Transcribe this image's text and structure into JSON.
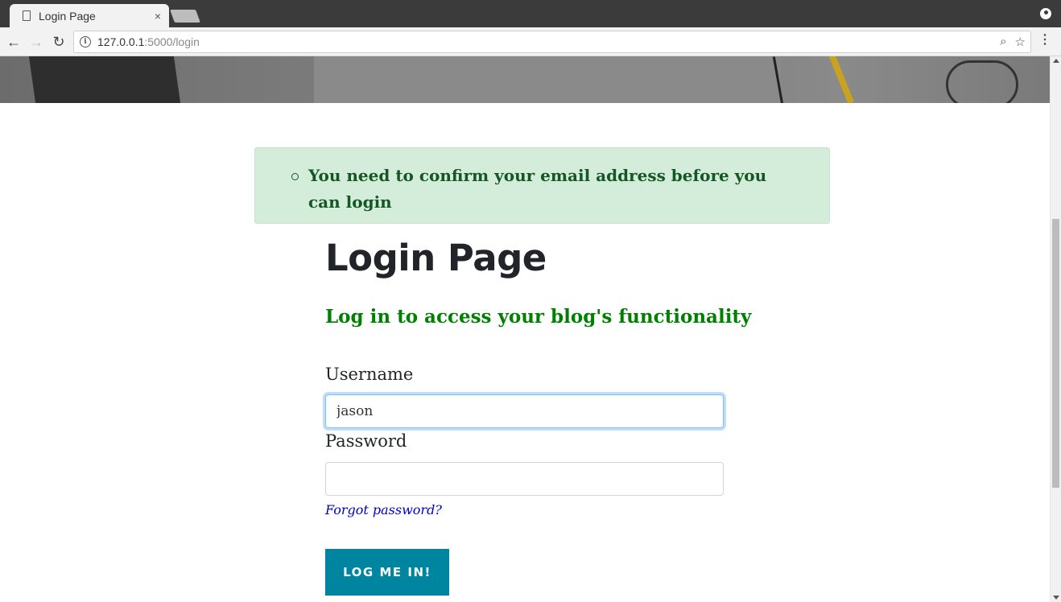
{
  "browser": {
    "tab_title": "Login Page",
    "tab_close": "×",
    "url_host": "127.0.0.1",
    "url_rest": ":5000/login",
    "back_icon": "←",
    "forward_icon": "→",
    "reload_icon": "↻",
    "zoom_icon": "⌕",
    "star_icon": "☆",
    "menu_icon": "⋮"
  },
  "flash": {
    "messages": [
      "You need to confirm your email address before you can login"
    ]
  },
  "page": {
    "title": "Login Page",
    "subtitle": "Log in to access your blog's functionality"
  },
  "form": {
    "username_label": "Username",
    "username_value": "jason",
    "password_label": "Password",
    "password_value": "",
    "forgot_link": "Forgot password?",
    "submit_label": "LOG ME IN!"
  },
  "colors": {
    "alert_bg": "#d4edda",
    "alert_text": "#155724",
    "subtitle": "#008000",
    "button": "#0085a1",
    "link": "#0000cc"
  }
}
